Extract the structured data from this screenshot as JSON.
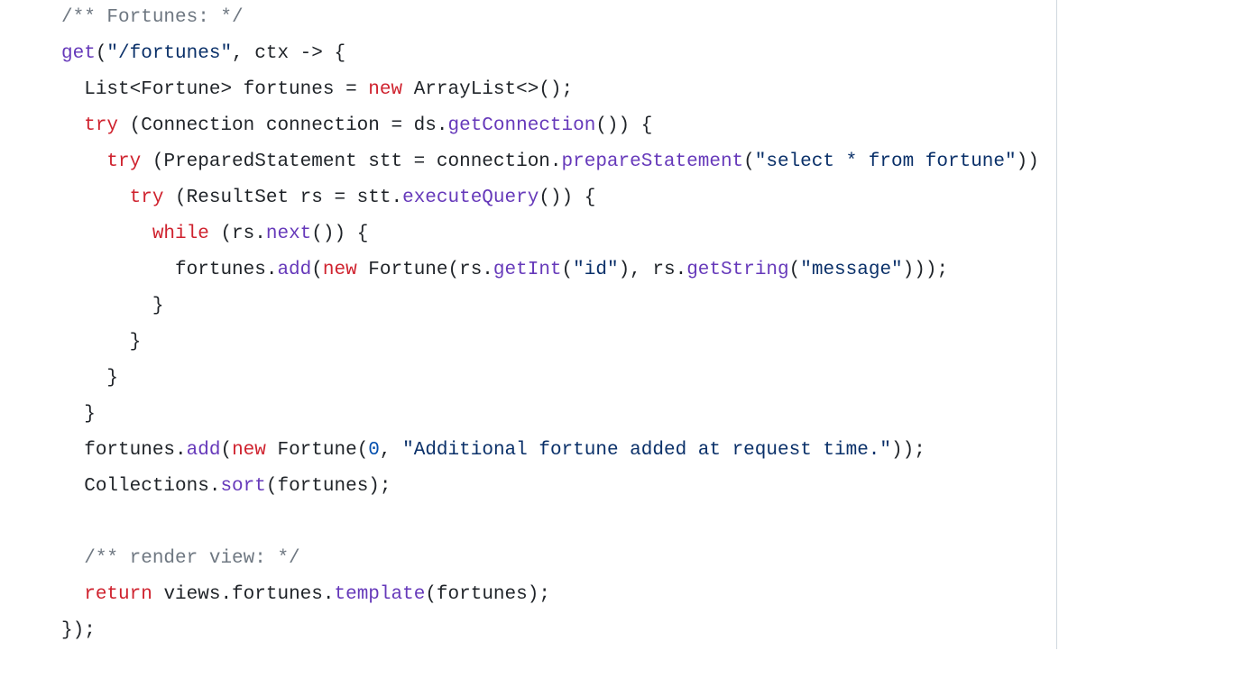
{
  "code": {
    "lines": [
      {
        "indent": 0,
        "tokens": [
          [
            "c",
            "/** Fortunes: */"
          ]
        ]
      },
      {
        "indent": 0,
        "tokens": [
          [
            "fn",
            "get"
          ],
          [
            "pl",
            "("
          ],
          [
            "str",
            "\"/fortunes\""
          ],
          [
            "pl",
            ", ctx -> {"
          ]
        ]
      },
      {
        "indent": 1,
        "tokens": [
          [
            "pl",
            "List<Fortune> fortunes = "
          ],
          [
            "kw",
            "new"
          ],
          [
            "pl",
            " ArrayList<>();"
          ]
        ]
      },
      {
        "indent": 1,
        "tokens": [
          [
            "kw",
            "try"
          ],
          [
            "pl",
            " (Connection connection = ds."
          ],
          [
            "fn",
            "getConnection"
          ],
          [
            "pl",
            "()) {"
          ]
        ]
      },
      {
        "indent": 2,
        "tokens": [
          [
            "kw",
            "try"
          ],
          [
            "pl",
            " (PreparedStatement stt = connection."
          ],
          [
            "fn",
            "prepareStatement"
          ],
          [
            "pl",
            "("
          ],
          [
            "str",
            "\"select * from fortune\""
          ],
          [
            "pl",
            "))"
          ]
        ]
      },
      {
        "indent": 3,
        "tokens": [
          [
            "kw",
            "try"
          ],
          [
            "pl",
            " (ResultSet rs = stt."
          ],
          [
            "fn",
            "executeQuery"
          ],
          [
            "pl",
            "()) {"
          ]
        ]
      },
      {
        "indent": 4,
        "tokens": [
          [
            "kw",
            "while"
          ],
          [
            "pl",
            " (rs."
          ],
          [
            "fn",
            "next"
          ],
          [
            "pl",
            "()) {"
          ]
        ]
      },
      {
        "indent": 5,
        "tokens": [
          [
            "pl",
            "fortunes."
          ],
          [
            "fn",
            "add"
          ],
          [
            "pl",
            "("
          ],
          [
            "kw",
            "new"
          ],
          [
            "pl",
            " Fortune(rs."
          ],
          [
            "fn",
            "getInt"
          ],
          [
            "pl",
            "("
          ],
          [
            "str",
            "\"id\""
          ],
          [
            "pl",
            "), rs."
          ],
          [
            "fn",
            "getString"
          ],
          [
            "pl",
            "("
          ],
          [
            "str",
            "\"message\""
          ],
          [
            "pl",
            ")));"
          ]
        ]
      },
      {
        "indent": 4,
        "tokens": [
          [
            "pl",
            "}"
          ]
        ]
      },
      {
        "indent": 3,
        "tokens": [
          [
            "pl",
            "}"
          ]
        ]
      },
      {
        "indent": 2,
        "tokens": [
          [
            "pl",
            "}"
          ]
        ]
      },
      {
        "indent": 1,
        "tokens": [
          [
            "pl",
            "}"
          ]
        ]
      },
      {
        "indent": 1,
        "tokens": [
          [
            "pl",
            "fortunes."
          ],
          [
            "fn",
            "add"
          ],
          [
            "pl",
            "("
          ],
          [
            "kw",
            "new"
          ],
          [
            "pl",
            " Fortune("
          ],
          [
            "num",
            "0"
          ],
          [
            "pl",
            ", "
          ],
          [
            "str",
            "\"Additional fortune added at request time.\""
          ],
          [
            "pl",
            "));"
          ]
        ]
      },
      {
        "indent": 1,
        "tokens": [
          [
            "pl",
            "Collections."
          ],
          [
            "fn",
            "sort"
          ],
          [
            "pl",
            "(fortunes);"
          ]
        ]
      },
      {
        "indent": 0,
        "tokens": [
          [
            "pl",
            ""
          ]
        ]
      },
      {
        "indent": 1,
        "tokens": [
          [
            "c",
            "/** render view: */"
          ]
        ]
      },
      {
        "indent": 1,
        "tokens": [
          [
            "kw",
            "return"
          ],
          [
            "pl",
            " views.fortunes."
          ],
          [
            "fn",
            "template"
          ],
          [
            "pl",
            "(fortunes);"
          ]
        ]
      },
      {
        "indent": 0,
        "tokens": [
          [
            "pl",
            "});"
          ]
        ]
      }
    ],
    "indent_unit": "  "
  }
}
